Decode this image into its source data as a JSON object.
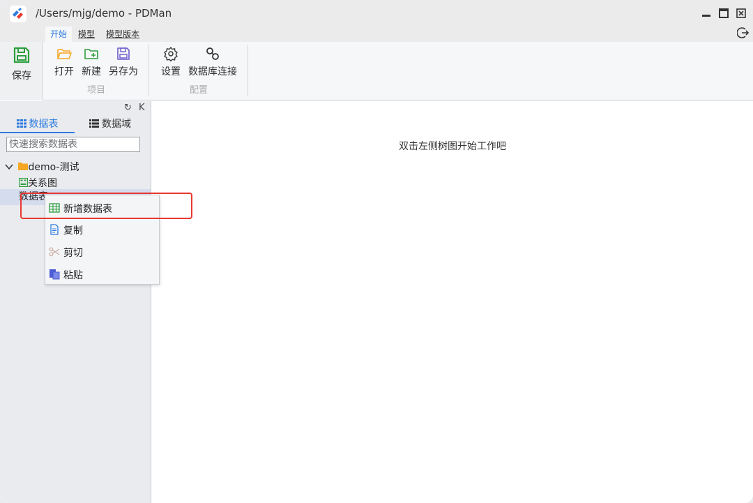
{
  "window": {
    "title": "/Users/mjg/demo - PDMan"
  },
  "ribbon": {
    "tabs": [
      "开始",
      "模型",
      "模型版本"
    ],
    "save_label": "保存",
    "project_group": {
      "label": "项目",
      "open": "打开",
      "new": "新建",
      "save_as": "另存为"
    },
    "config_group": {
      "label": "配置",
      "settings": "设置",
      "db_connect": "数据库连接"
    }
  },
  "sidebar": {
    "tool_refresh": "↻",
    "tool_collapse": "K",
    "tab_tables": "数据表",
    "tab_domains": "数据域",
    "search_placeholder": "快速搜索数据表",
    "tree": {
      "root": "demo-测试",
      "relation": "关系图",
      "tables": "数据表"
    }
  },
  "main": {
    "hint": "双击左侧树图开始工作吧"
  },
  "context_menu": {
    "items": [
      "新增数据表",
      "复制",
      "剪切",
      "粘贴"
    ]
  },
  "colors": {
    "accent": "#2f7ce0",
    "highlight": "#e8382f",
    "folder": "#f5a623",
    "green": "#2e9e3d"
  }
}
